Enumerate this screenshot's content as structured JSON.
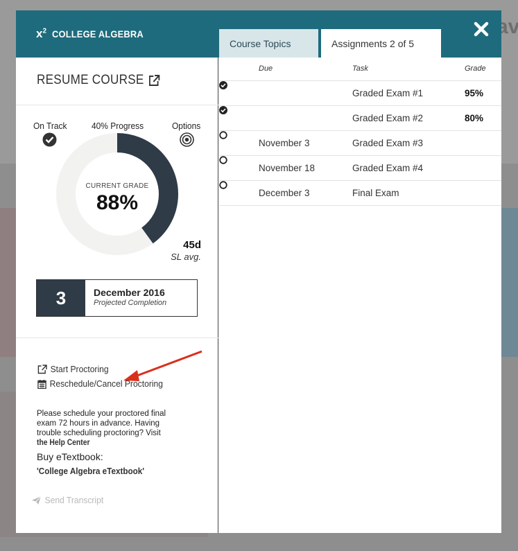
{
  "background": {
    "edge_text": "av"
  },
  "header": {
    "logo": "x",
    "logo_sup": "2",
    "course_name": "COLLEGE ALGEBRA",
    "close_icon": "close-x-icon"
  },
  "tabs": [
    {
      "label": "Course Topics",
      "active": false
    },
    {
      "label": "Assignments 2 of 5",
      "active": true
    }
  ],
  "left": {
    "resume_label": "RESUME COURSE",
    "on_track_label": "On Track",
    "progress_label": "40% Progress",
    "options_label": "Options",
    "progress_percent": 40,
    "current_grade_label": "CURRENT GRADE",
    "current_grade_value": "88%",
    "sl_days": "45d",
    "sl_avg_label": "SL avg.",
    "projection_number": "3",
    "projection_date": "December 2016",
    "projection_sub": "Projected Completion",
    "start_proctoring": "Start Proctoring",
    "reschedule_proctoring": "Reschedule/Cancel Proctoring",
    "note_text": "Please schedule your proctored final exam 72 hours in advance. Having trouble scheduling proctoring? Visit ",
    "note_link": "the Help Center",
    "buy_label": "Buy eTextbook:",
    "buy_link": "'College Algebra eTextbook'",
    "send_transcript": "Send Transcript"
  },
  "assignments": {
    "columns": {
      "due": "Due",
      "task": "Task",
      "grade": "Grade"
    },
    "rows": [
      {
        "complete": true,
        "due": "",
        "task": "Graded Exam #1",
        "grade": "95%"
      },
      {
        "complete": true,
        "due": "",
        "task": "Graded Exam #2",
        "grade": "80%"
      },
      {
        "complete": false,
        "due": "November 3",
        "task": "Graded Exam #3",
        "grade": ""
      },
      {
        "complete": false,
        "due": "November 18",
        "task": "Graded Exam #4",
        "grade": ""
      },
      {
        "complete": false,
        "due": "December 3",
        "task": "Final Exam",
        "grade": ""
      }
    ]
  },
  "colors": {
    "header": "#1e6b7d",
    "tab_inactive": "#d8e6ea",
    "donut_track": "#f2f2f0",
    "donut_fill": "#2f3b47",
    "annotation_arrow": "#d9301c"
  }
}
